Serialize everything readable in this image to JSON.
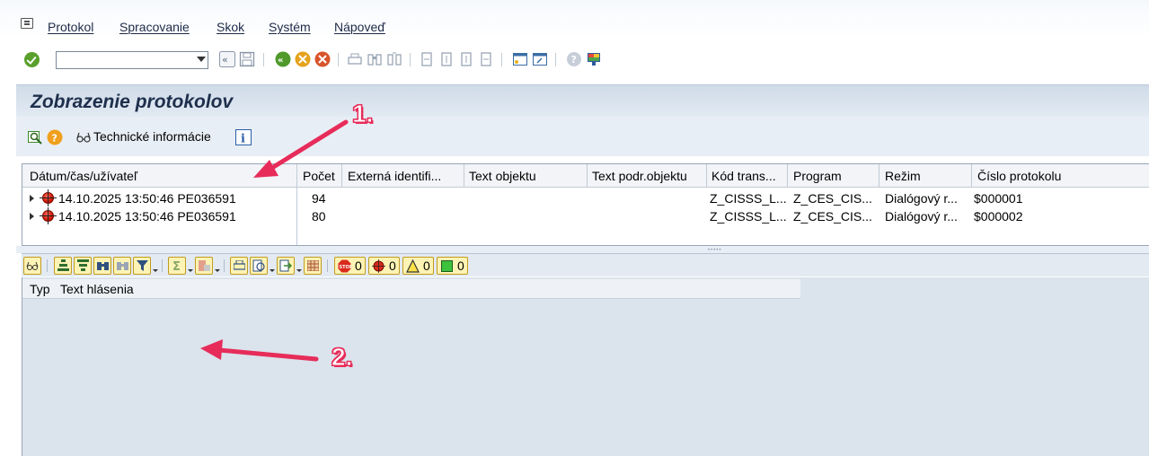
{
  "menubar": {
    "items": [
      "Protokol",
      "Spracovanie",
      "Skok",
      "Systém",
      "Nápoveď"
    ]
  },
  "toolbar": {
    "command_value": "",
    "icons": [
      "enter-icon",
      "back-icon",
      "save-icon",
      "back-green-icon",
      "exit-icon",
      "cancel-icon",
      "print-icon",
      "find-icon",
      "find-next-icon",
      "first-page-icon",
      "prev-page-icon",
      "next-page-icon",
      "last-page-icon",
      "create-session-icon",
      "shortcut-icon",
      "help-icon",
      "customize-layout-icon"
    ]
  },
  "page": {
    "title": "Zobrazenie protokolov"
  },
  "app_toolbar": {
    "technical_info_label": "Technické informácie"
  },
  "log_table": {
    "columns": [
      "Dátum/čas/užívateľ",
      "Počet",
      "Externá identifi...",
      "Text objektu",
      "Text podr.objektu",
      "Kód trans...",
      "Program",
      "Režim",
      "Číslo protokolu"
    ],
    "rows": [
      {
        "datetime_user": "14.10.2025  13:50:46  PE036591",
        "count": "94",
        "external_id": "",
        "object_text": "",
        "subobject_text": "",
        "tcode": "Z_CISSS_L...",
        "program": "Z_CES_CIS...",
        "mode": "Dialógový r...",
        "log_number": "$000001"
      },
      {
        "datetime_user": "14.10.2025  13:50:46  PE036591",
        "count": "80",
        "external_id": "",
        "object_text": "",
        "subobject_text": "",
        "tcode": "Z_CISSS_L...",
        "program": "Z_CES_CIS...",
        "mode": "Dialógový r...",
        "log_number": "$000002"
      }
    ]
  },
  "alv_toolbar": {
    "stop_count": "0",
    "error_count": "0",
    "warning_count": "0",
    "info_count": "0"
  },
  "message_table": {
    "columns": [
      "Typ",
      "Text hlásenia"
    ]
  },
  "annotations": {
    "label_1": "1.",
    "label_2": "2.",
    "color": "#e72c5a"
  }
}
